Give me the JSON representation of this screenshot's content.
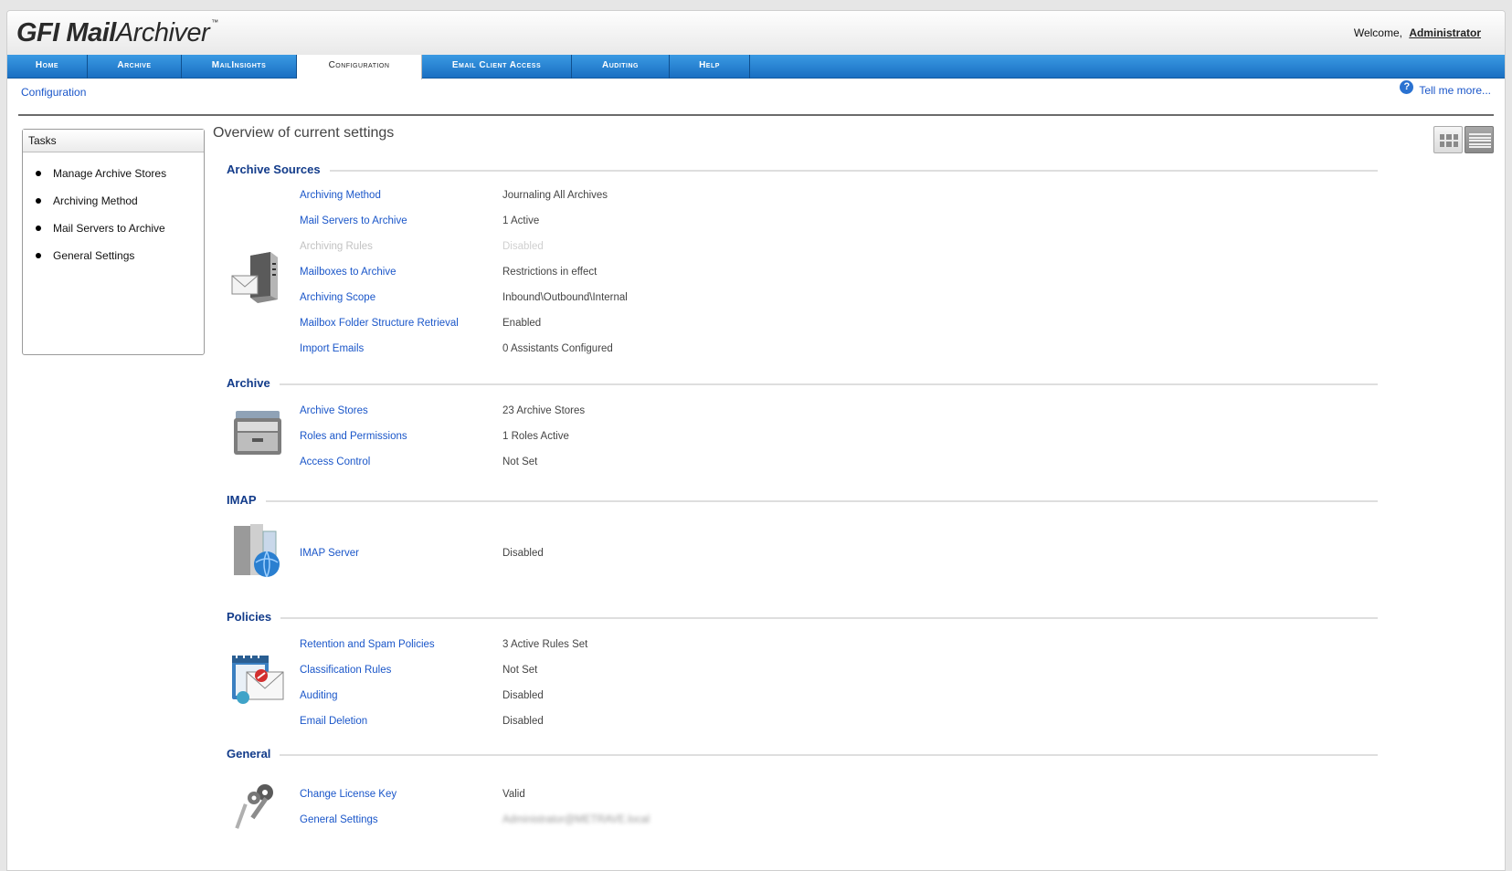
{
  "app": {
    "logo_gfi": "GFI",
    "logo_mail": "Mail",
    "logo_archiver": "Archiver",
    "logo_tm": "™"
  },
  "header": {
    "welcome_text": "Welcome,",
    "user": "Administrator"
  },
  "nav": {
    "tabs": [
      {
        "label": "Home",
        "active": false
      },
      {
        "label": "Archive",
        "active": false
      },
      {
        "label": "MailInsights",
        "active": false
      },
      {
        "label": "Configuration",
        "active": true
      },
      {
        "label": "Email Client Access",
        "active": false
      },
      {
        "label": "Auditing",
        "active": false
      },
      {
        "label": "Help",
        "active": false
      }
    ]
  },
  "breadcrumb": "Configuration",
  "help_link": "Tell me more...",
  "tasks": {
    "title": "Tasks",
    "items": [
      "Manage Archive Stores",
      "Archiving Method",
      "Mail Servers to Archive",
      "General Settings"
    ]
  },
  "overview_title": "Overview of current settings",
  "sections": {
    "archive_sources": {
      "title": "Archive Sources",
      "rows": [
        {
          "label": "Archiving Method",
          "value": "Journaling All Archives"
        },
        {
          "label": "Mail Servers to Archive",
          "value": "1 Active"
        },
        {
          "label": "Archiving Rules",
          "value": "Disabled"
        },
        {
          "label": "Mailboxes to Archive",
          "value": "Restrictions in effect"
        },
        {
          "label": "Archiving Scope",
          "value": "Inbound\\Outbound\\Internal"
        },
        {
          "label": "Mailbox Folder Structure Retrieval",
          "value": "Enabled"
        },
        {
          "label": "Import Emails",
          "value": "0 Assistants Configured"
        }
      ]
    },
    "archive": {
      "title": "Archive",
      "rows": [
        {
          "label": "Archive Stores",
          "value": "23 Archive Stores"
        },
        {
          "label": "Roles and Permissions",
          "value": "1 Roles Active"
        },
        {
          "label": "Access Control",
          "value": "Not Set"
        }
      ]
    },
    "imap": {
      "title": "IMAP",
      "rows": [
        {
          "label": "IMAP Server",
          "value": "Disabled"
        }
      ]
    },
    "policies": {
      "title": "Policies",
      "rows": [
        {
          "label": "Retention and Spam Policies",
          "value": "3 Active Rules Set"
        },
        {
          "label": "Classification Rules",
          "value": "Not Set"
        },
        {
          "label": "Auditing",
          "value": "Disabled"
        },
        {
          "label": "Email Deletion",
          "value": "Disabled"
        }
      ]
    },
    "general": {
      "title": "General",
      "rows": [
        {
          "label": "Change License Key",
          "value": "Valid"
        },
        {
          "label": "General Settings",
          "value": "Administrator@METRAVE.local"
        }
      ]
    }
  }
}
